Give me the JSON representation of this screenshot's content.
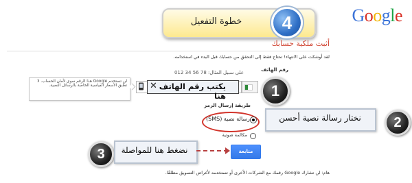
{
  "logo": {
    "text": "Google"
  },
  "banner": {
    "step_number": "4",
    "text": "خطوة التفعيل"
  },
  "page": {
    "title": "أثبت ملكية حسابك",
    "intro": "لقد أوشكت على الانتهاء! تحتاج فقط إلى التحقق من حسابك قبل البدء في استخدامه."
  },
  "phone": {
    "label": "رقم الهاتف",
    "example": "على سبيل المثال: 78 56 34 012",
    "value": "يكتب رقم الهاتف هنا",
    "clear_icon": "close-icon",
    "device_icon": "mobile-phone-icon"
  },
  "tooltip": {
    "text": "لن تستخدم Google هذا الرقم سوى لأمان الحساب. لا تطبق الأسعار القياسية الخاصة بالرسائل النصية."
  },
  "method": {
    "label": "طريقة إرسال الرمز",
    "sms_label": "رسالة نصية (SMS)",
    "voice_label": "مكالمة صوتية",
    "selected": "sms"
  },
  "annotations": {
    "step1": "1",
    "step2_number": "2",
    "step2_text": "نختار رسالة نصية أحسن",
    "step3_number": "3",
    "step3_text": "نضغط هنا للمواصلة"
  },
  "continue_button": {
    "label": "متابعة"
  },
  "footer": {
    "text": "هام: لن تشارك Google رقمك مع الشركات الأخرى أو تستخدمه لأغراض التسويق مطلقًا."
  },
  "colors": {
    "accent_red": "#d14836",
    "button_blue": "#4d90fe",
    "badge_blue": "#2f6fc6",
    "badge_dark": "#222222"
  }
}
